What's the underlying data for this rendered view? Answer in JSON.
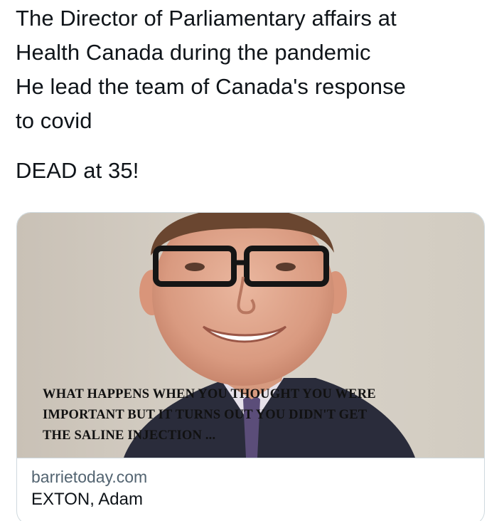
{
  "tweet": {
    "lines": [
      "The Director of Parliamentary affairs at",
      "Health Canada during the pandemic",
      "He lead the team of Canada's response",
      "to covid"
    ],
    "second_paragraph": "DEAD at 35!"
  },
  "card": {
    "image_caption_lines": [
      "WHAT HAPPENS WHEN YOU THOUGHT YOU WERE",
      "IMPORTANT BUT IT TURNS OUT YOU DIDN'T GET",
      "THE SALINE INJECTION ..."
    ],
    "domain": "barrietoday.com",
    "title": "EXTON, Adam"
  },
  "colors": {
    "text_primary": "#0f1419",
    "text_secondary": "#536471",
    "border": "#cfd9de"
  }
}
